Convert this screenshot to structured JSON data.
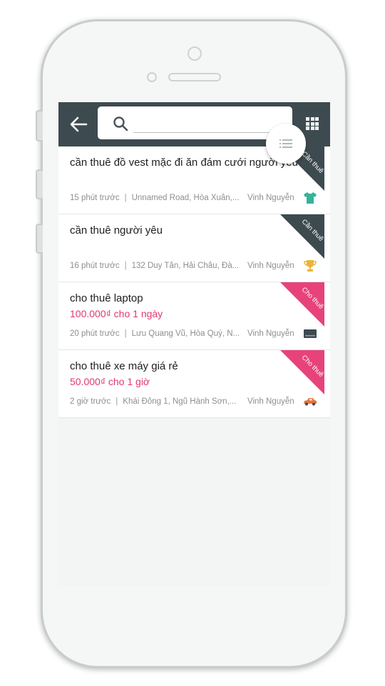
{
  "header": {
    "search_placeholder": ""
  },
  "listings": [
    {
      "title": "cần thuê đồ vest mặc đi ăn đám cưới người yêu",
      "price": "",
      "time": "15 phút trước",
      "location": "Unnamed Road, Hòa Xuân,...",
      "author": "Vinh Nguyễn",
      "tag": "Cần thuê",
      "tag_color": "#3d4a50",
      "icon": "tshirt-icon",
      "icon_color": "#36b39a"
    },
    {
      "title": "cần thuê người yêu",
      "price": "",
      "time": "16 phút trước",
      "location": "132 Duy Tân, Hải Châu, Đà...",
      "author": "Vinh Nguyễn",
      "tag": "Cần thuê",
      "tag_color": "#3d4a50",
      "icon": "trophy-icon",
      "icon_color": "#e9b63a"
    },
    {
      "title": "cho thuê laptop",
      "price": "100.000₫ cho 1 ngày",
      "time": "20 phút trước",
      "location": "Lưu Quang Vũ, Hòa Quý, N...",
      "author": "Vinh Nguyễn",
      "tag": "Cho thuê",
      "tag_color": "#e7437a",
      "icon": "laptop-icon",
      "icon_color": "#3d4a50"
    },
    {
      "title": "cho thuê xe máy giá rẻ",
      "price": "50.000₫ cho 1 giờ",
      "time": "2 giờ trước",
      "location": "Khái Đông 1, Ngũ Hành Sơn,...",
      "author": "Vinh Nguyễn",
      "tag": "Cho thuê",
      "tag_color": "#e7437a",
      "icon": "car-icon",
      "icon_color": "#e8733f"
    }
  ],
  "theme": {
    "topbar": "#3d4a50",
    "accent": "#e7437a",
    "price": "#e0386f"
  }
}
